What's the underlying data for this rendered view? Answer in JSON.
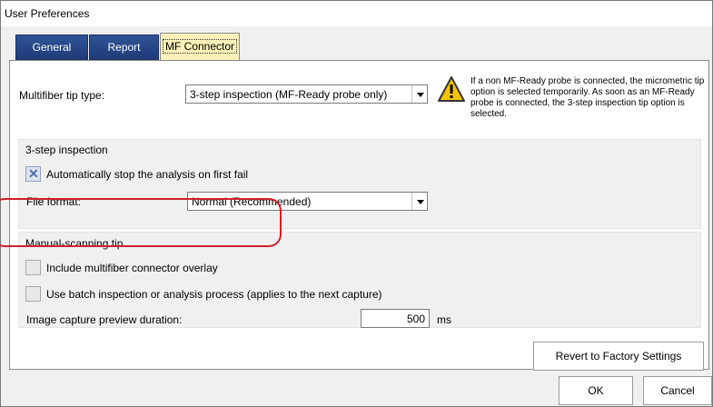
{
  "window": {
    "title": "User Preferences"
  },
  "tabs": [
    {
      "label": "General",
      "active": false
    },
    {
      "label": "Report",
      "active": false
    },
    {
      "label": "MF Connector",
      "active": true
    }
  ],
  "multifiber": {
    "label": "Multifiber tip type:",
    "selected": "3-step inspection (MF-Ready probe only)",
    "warning_icon": "warning-triangle-icon",
    "warning_text": "If a non MF-Ready probe is connected, the micrometric tip option is selected temporarily. As soon as an MF-Ready probe is connected, the 3-step inspection tip option is selected."
  },
  "three_step": {
    "heading": "3-step inspection",
    "auto_stop_label": "Automatically stop the analysis on first fail",
    "auto_stop_checked": true,
    "file_format_label": "File format:",
    "file_format_selected": "Normal (Recommended)"
  },
  "manual": {
    "heading": "Manual-scanning tip",
    "overlay_label": "Include multifiber connector overlay",
    "overlay_checked": false,
    "batch_label": "Use batch inspection or analysis process (applies to the next capture)",
    "batch_checked": false,
    "preview_label": "Image capture preview duration:",
    "preview_value": "500",
    "preview_unit": "ms"
  },
  "buttons": {
    "revert": "Revert to Factory Settings",
    "ok": "OK",
    "cancel": "Cancel"
  },
  "colors": {
    "tab_active_bg": "#fdf0b8",
    "tab_inactive_bg": "#1f3b78",
    "highlight_ring": "#d0202a",
    "warning_yellow": "#f5c400"
  }
}
